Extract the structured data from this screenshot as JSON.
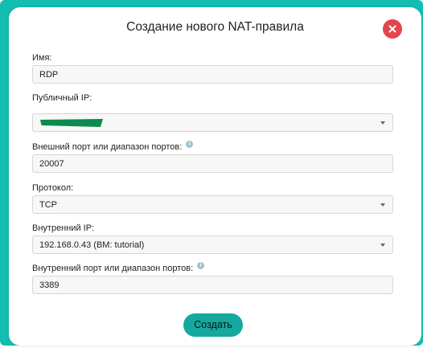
{
  "dialog": {
    "title": "Создание нового NAT-правила",
    "accent_color": "#14bdb1",
    "close_color": "#e4454b"
  },
  "form": {
    "name": {
      "label": "Имя:",
      "value": "RDP"
    },
    "public_ip": {
      "label": "Публичный IP:",
      "value": ""
    },
    "external_port": {
      "label": "Внешний порт или диапазон портов:",
      "value": "20007",
      "info_icon": "i"
    },
    "protocol": {
      "label": "Протокол:",
      "value": "TCP"
    },
    "internal_ip": {
      "label": "Внутренний IP:",
      "value": "192.168.0.43 (ВМ: tutorial)"
    },
    "internal_port": {
      "label": "Внутренний порт или диапазон портов:",
      "value": "3389",
      "info_icon": "i"
    }
  },
  "actions": {
    "create_label": "Создать"
  }
}
